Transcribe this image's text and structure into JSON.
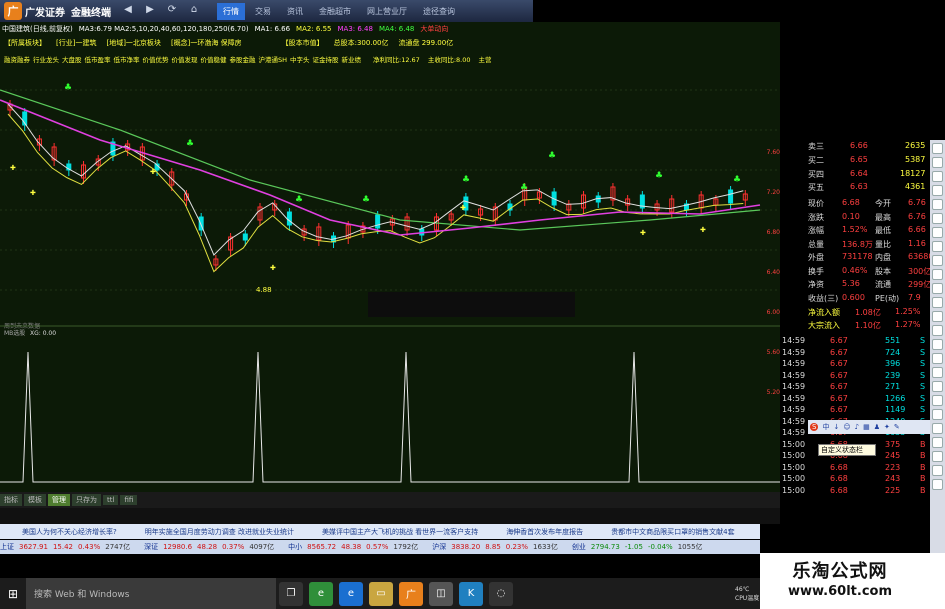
{
  "window": {
    "brand": "广发证券",
    "app": "金融终端",
    "menu": [
      {
        "label": "行情",
        "active": true
      },
      {
        "label": "交易",
        "active": false
      },
      {
        "label": "资讯",
        "active": false
      },
      {
        "label": "金融超市",
        "active": false
      },
      {
        "label": "网上营业厅",
        "active": false
      },
      {
        "label": "途径查询",
        "active": false
      }
    ]
  },
  "header": {
    "stock": "中国建筑(日线,前复权)",
    "ma": "MA3:6.79 MA2:5,10,20,40,60,120,180,250(6.70)",
    "ma1": "MA1: 6.66",
    "ma2": "MA2: 6.55",
    "ma3": "MA3: 6.48",
    "ma4": "MA4: 6.48",
    "extra": "大单动向"
  },
  "row2": {
    "items": [
      "【所属板块】",
      "[行业]一建筑",
      "[地域]一北京板块",
      "[概念]一环渤海 保障房"
    ],
    "board": "【股本市值】",
    "total_share": "总股本:300.00亿",
    "float_share": "流通盘 299.00亿"
  },
  "row3": {
    "items": [
      "融资融券",
      "行业龙头",
      "大盘股",
      "低市盈率",
      "低市净率",
      "价值优势",
      "价值发现",
      "价值稳健",
      "参股金融",
      "沪港通SH",
      "中字头",
      "证金持股",
      "新业绩"
    ],
    "net_profit": "净利同比:12.67",
    "revenue": "主收同比:8.00",
    "main": "主营"
  },
  "main_chart": {
    "low_label": "4.88",
    "sub_name": "MB选股",
    "sub_value": "XG: 0.00",
    "empty_label": "周到未来数据"
  },
  "axis_right": {
    "ticks": [
      "7.60",
      "7.20",
      "6.80",
      "6.40",
      "6.00",
      "5.60",
      "5.20"
    ]
  },
  "orderbook": {
    "asks": [
      {
        "label": "卖三",
        "price": "6.66",
        "vol": "2635"
      },
      {
        "label": "买二",
        "price": "6.65",
        "vol": "5387"
      },
      {
        "label": "买四",
        "price": "6.64",
        "vol": "18127"
      },
      {
        "label": "买五",
        "price": "6.63",
        "vol": "4361"
      }
    ],
    "stats": [
      {
        "l1": "现价",
        "v1": "6.68",
        "l2": "今开",
        "v2": "6.76"
      },
      {
        "l1": "涨跌",
        "v1": "0.10",
        "l2": "最高",
        "v2": "6.76"
      },
      {
        "l1": "涨幅",
        "v1": "1.52%",
        "l2": "最低",
        "v2": "6.66"
      },
      {
        "l1": "总量",
        "v1": "136.8万",
        "l2": "量比",
        "v2": "1.16"
      },
      {
        "l1": "外盘",
        "v1": "731178",
        "l2": "内盘",
        "v2": "636806"
      },
      {
        "l1": "换手",
        "v1": "0.46%",
        "l2": "股本",
        "v2": "300亿"
      },
      {
        "l1": "净资",
        "v1": "5.36",
        "l2": "流通",
        "v2": "299亿"
      },
      {
        "l1": "收益(三)",
        "v1": "0.600",
        "l2": "PE(动)",
        "v2": "7.9"
      }
    ],
    "flow": [
      {
        "label": "净流入额",
        "value": "1.08亿",
        "pct": "1.25%"
      },
      {
        "label": "大宗流入",
        "value": "1.10亿",
        "pct": "1.27%"
      }
    ]
  },
  "ticks": [
    [
      "14:59",
      "6.67",
      "551",
      "S"
    ],
    [
      "14:59",
      "6.67",
      "724",
      "S"
    ],
    [
      "14:59",
      "6.67",
      "396",
      "S"
    ],
    [
      "14:59",
      "6.67",
      "239",
      "S"
    ],
    [
      "14:59",
      "6.67",
      "271",
      "S"
    ],
    [
      "14:59",
      "6.67",
      "1266",
      "S"
    ],
    [
      "14:59",
      "6.67",
      "1149",
      "S"
    ],
    [
      "14:59",
      "6.67",
      "1240",
      "S"
    ],
    [
      "14:59",
      "6.67",
      "1033",
      "S"
    ],
    [
      "15:00",
      "6.68",
      "375",
      "B"
    ],
    [
      "15:00",
      "6.68",
      "245",
      "B"
    ],
    [
      "15:00",
      "6.68",
      "223",
      "B"
    ],
    [
      "15:00",
      "6.68",
      "243",
      "B"
    ],
    [
      "15:00",
      "6.68",
      "225",
      "B"
    ]
  ],
  "tool_tip": "自定义状态栏",
  "tabs": [
    {
      "label": "指标",
      "active": false
    },
    {
      "label": "模板",
      "active": false
    },
    {
      "label": "管理",
      "active": true
    },
    {
      "label": "只存为",
      "active": false
    },
    {
      "label": "ttl",
      "active": false
    },
    {
      "label": "fifi",
      "active": false
    }
  ],
  "news": [
    "美国人为何不关心经济增长率?",
    "明年实施全国月度劳动力调查 改进就业失业统计",
    "美媒评中国主产大飞机的挑战 看世界一流客户支持",
    "海伸香首次发布年度报告",
    "贵都市中文商品限买口罩的销售文献4套"
  ],
  "ticker": [
    {
      "name": "上证",
      "value": "3627.91",
      "chg": "15.42",
      "pct": "0.43%",
      "vol": "2747亿"
    },
    {
      "name": "深证",
      "value": "12980.6",
      "chg": "48.28",
      "pct": "0.37%",
      "vol": "4097亿"
    },
    {
      "name": "中小",
      "value": "8565.72",
      "chg": "48.38",
      "pct": "0.57%",
      "vol": "1792亿"
    },
    {
      "name": "沪深",
      "value": "3838.20",
      "chg": "8.85",
      "pct": "0.23%",
      "vol": "1633亿"
    },
    {
      "name": "创业",
      "value": "2794.73",
      "chg": "-1.05",
      "pct": "-0.04%",
      "vol": "1055亿"
    }
  ],
  "taskbar": {
    "search": "搜索 Web 和 Windows",
    "temp": "46℃",
    "cpu": "CPU温度"
  },
  "watermark": {
    "line1": "乐淘公式网",
    "line2": "www.60lt.com"
  },
  "colors": {
    "up": "#ff3030",
    "down": "#00e0e0",
    "yellow": "#ffff40",
    "bg_chart": "#0c1a07"
  }
}
